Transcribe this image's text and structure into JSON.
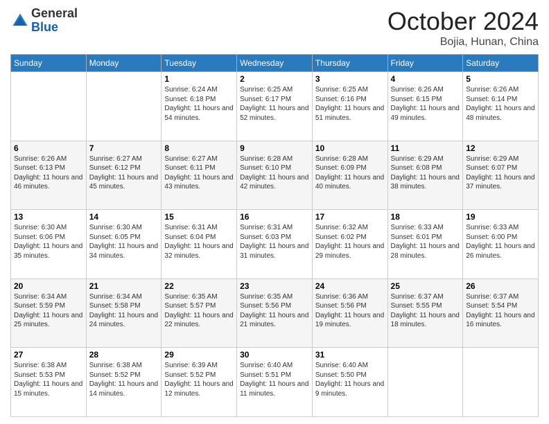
{
  "header": {
    "logo": {
      "general": "General",
      "blue": "Blue"
    },
    "title": "October 2024",
    "location": "Bojia, Hunan, China"
  },
  "days_of_week": [
    "Sunday",
    "Monday",
    "Tuesday",
    "Wednesday",
    "Thursday",
    "Friday",
    "Saturday"
  ],
  "weeks": [
    [
      null,
      null,
      {
        "num": "1",
        "sunrise": "6:24 AM",
        "sunset": "6:18 PM",
        "daylight": "11 hours and 54 minutes."
      },
      {
        "num": "2",
        "sunrise": "6:25 AM",
        "sunset": "6:17 PM",
        "daylight": "11 hours and 52 minutes."
      },
      {
        "num": "3",
        "sunrise": "6:25 AM",
        "sunset": "6:16 PM",
        "daylight": "11 hours and 51 minutes."
      },
      {
        "num": "4",
        "sunrise": "6:26 AM",
        "sunset": "6:15 PM",
        "daylight": "11 hours and 49 minutes."
      },
      {
        "num": "5",
        "sunrise": "6:26 AM",
        "sunset": "6:14 PM",
        "daylight": "11 hours and 48 minutes."
      }
    ],
    [
      {
        "num": "6",
        "sunrise": "6:26 AM",
        "sunset": "6:13 PM",
        "daylight": "11 hours and 46 minutes."
      },
      {
        "num": "7",
        "sunrise": "6:27 AM",
        "sunset": "6:12 PM",
        "daylight": "11 hours and 45 minutes."
      },
      {
        "num": "8",
        "sunrise": "6:27 AM",
        "sunset": "6:11 PM",
        "daylight": "11 hours and 43 minutes."
      },
      {
        "num": "9",
        "sunrise": "6:28 AM",
        "sunset": "6:10 PM",
        "daylight": "11 hours and 42 minutes."
      },
      {
        "num": "10",
        "sunrise": "6:28 AM",
        "sunset": "6:09 PM",
        "daylight": "11 hours and 40 minutes."
      },
      {
        "num": "11",
        "sunrise": "6:29 AM",
        "sunset": "6:08 PM",
        "daylight": "11 hours and 38 minutes."
      },
      {
        "num": "12",
        "sunrise": "6:29 AM",
        "sunset": "6:07 PM",
        "daylight": "11 hours and 37 minutes."
      }
    ],
    [
      {
        "num": "13",
        "sunrise": "6:30 AM",
        "sunset": "6:06 PM",
        "daylight": "11 hours and 35 minutes."
      },
      {
        "num": "14",
        "sunrise": "6:30 AM",
        "sunset": "6:05 PM",
        "daylight": "11 hours and 34 minutes."
      },
      {
        "num": "15",
        "sunrise": "6:31 AM",
        "sunset": "6:04 PM",
        "daylight": "11 hours and 32 minutes."
      },
      {
        "num": "16",
        "sunrise": "6:31 AM",
        "sunset": "6:03 PM",
        "daylight": "11 hours and 31 minutes."
      },
      {
        "num": "17",
        "sunrise": "6:32 AM",
        "sunset": "6:02 PM",
        "daylight": "11 hours and 29 minutes."
      },
      {
        "num": "18",
        "sunrise": "6:33 AM",
        "sunset": "6:01 PM",
        "daylight": "11 hours and 28 minutes."
      },
      {
        "num": "19",
        "sunrise": "6:33 AM",
        "sunset": "6:00 PM",
        "daylight": "11 hours and 26 minutes."
      }
    ],
    [
      {
        "num": "20",
        "sunrise": "6:34 AM",
        "sunset": "5:59 PM",
        "daylight": "11 hours and 25 minutes."
      },
      {
        "num": "21",
        "sunrise": "6:34 AM",
        "sunset": "5:58 PM",
        "daylight": "11 hours and 24 minutes."
      },
      {
        "num": "22",
        "sunrise": "6:35 AM",
        "sunset": "5:57 PM",
        "daylight": "11 hours and 22 minutes."
      },
      {
        "num": "23",
        "sunrise": "6:35 AM",
        "sunset": "5:56 PM",
        "daylight": "11 hours and 21 minutes."
      },
      {
        "num": "24",
        "sunrise": "6:36 AM",
        "sunset": "5:56 PM",
        "daylight": "11 hours and 19 minutes."
      },
      {
        "num": "25",
        "sunrise": "6:37 AM",
        "sunset": "5:55 PM",
        "daylight": "11 hours and 18 minutes."
      },
      {
        "num": "26",
        "sunrise": "6:37 AM",
        "sunset": "5:54 PM",
        "daylight": "11 hours and 16 minutes."
      }
    ],
    [
      {
        "num": "27",
        "sunrise": "6:38 AM",
        "sunset": "5:53 PM",
        "daylight": "11 hours and 15 minutes."
      },
      {
        "num": "28",
        "sunrise": "6:38 AM",
        "sunset": "5:52 PM",
        "daylight": "11 hours and 14 minutes."
      },
      {
        "num": "29",
        "sunrise": "6:39 AM",
        "sunset": "5:52 PM",
        "daylight": "11 hours and 12 minutes."
      },
      {
        "num": "30",
        "sunrise": "6:40 AM",
        "sunset": "5:51 PM",
        "daylight": "11 hours and 11 minutes."
      },
      {
        "num": "31",
        "sunrise": "6:40 AM",
        "sunset": "5:50 PM",
        "daylight": "11 hours and 9 minutes."
      },
      null,
      null
    ]
  ]
}
